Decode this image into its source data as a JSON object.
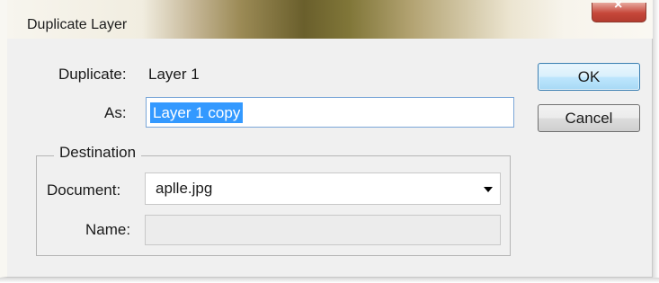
{
  "window": {
    "title": "Duplicate Layer",
    "close_icon": "close-icon"
  },
  "duplicate": {
    "label": "Duplicate:",
    "value": "Layer 1"
  },
  "as_field": {
    "label": "As:",
    "value": "Layer 1 copy"
  },
  "buttons": {
    "ok": "OK",
    "cancel": "Cancel"
  },
  "destination": {
    "legend": "Destination",
    "document_label": "Document:",
    "document_value": "aplle.jpg",
    "dropdown_icon": "dropdown-arrow-icon",
    "name_label": "Name:",
    "name_value": ""
  },
  "colors": {
    "selection": "#3399ff",
    "ok_border": "#3c7fb1",
    "close_button": "#c6473a"
  }
}
